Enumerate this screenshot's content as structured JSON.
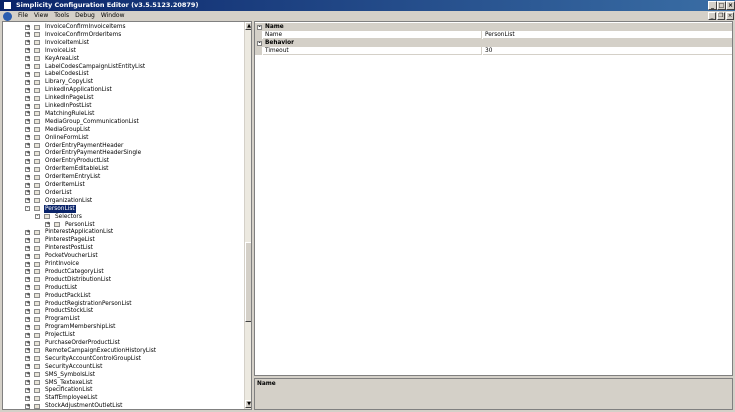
{
  "window": {
    "title": "Simplicity Configuration Editor (v3.5.5123.20879)"
  },
  "menu": [
    "File",
    "View",
    "Tools",
    "Debug",
    "Window"
  ],
  "tree": {
    "items": [
      {
        "label": "InvoiceConfirmInvoiceItems",
        "level": 0,
        "expander": "+"
      },
      {
        "label": "InvoiceConfirmOrderItems",
        "level": 0,
        "expander": "+"
      },
      {
        "label": "InvoiceItemList",
        "level": 0,
        "expander": "+"
      },
      {
        "label": "InvoiceList",
        "level": 0,
        "expander": "+"
      },
      {
        "label": "KeyAreaList",
        "level": 0,
        "expander": "+"
      },
      {
        "label": "LabelCodesCampaignListEntityList",
        "level": 0,
        "expander": "+"
      },
      {
        "label": "LabelCodesList",
        "level": 0,
        "expander": "+"
      },
      {
        "label": "Library_CopyList",
        "level": 0,
        "expander": "+"
      },
      {
        "label": "LinkedInApplicationList",
        "level": 0,
        "expander": "+"
      },
      {
        "label": "LinkedInPageList",
        "level": 0,
        "expander": "+"
      },
      {
        "label": "LinkedInPostList",
        "level": 0,
        "expander": "+"
      },
      {
        "label": "MatchingRuleList",
        "level": 0,
        "expander": "+"
      },
      {
        "label": "MediaGroup_CommunicationList",
        "level": 0,
        "expander": "+"
      },
      {
        "label": "MediaGroupList",
        "level": 0,
        "expander": "+"
      },
      {
        "label": "OnlineFormList",
        "level": 0,
        "expander": "+"
      },
      {
        "label": "OrderEntryPaymentHeader",
        "level": 0,
        "expander": "+"
      },
      {
        "label": "OrderEntryPaymentHeaderSingle",
        "level": 0,
        "expander": "+"
      },
      {
        "label": "OrderEntryProductList",
        "level": 0,
        "expander": "+"
      },
      {
        "label": "OrderItemEditableList",
        "level": 0,
        "expander": "+"
      },
      {
        "label": "OrderItemEntryList",
        "level": 0,
        "expander": "+"
      },
      {
        "label": "OrderItemList",
        "level": 0,
        "expander": "+"
      },
      {
        "label": "OrderList",
        "level": 0,
        "expander": "+"
      },
      {
        "label": "OrganizationList",
        "level": 0,
        "expander": "+"
      },
      {
        "label": "PersonList",
        "level": 0,
        "expander": "-",
        "selected": true
      },
      {
        "label": "Selectors",
        "level": 1,
        "expander": "-"
      },
      {
        "label": "PersonList",
        "level": 2,
        "expander": "+"
      },
      {
        "label": "PinterestApplicationList",
        "level": 0,
        "expander": "+"
      },
      {
        "label": "PinterestPageList",
        "level": 0,
        "expander": "+"
      },
      {
        "label": "PinterestPostList",
        "level": 0,
        "expander": "+"
      },
      {
        "label": "PocketVoucherList",
        "level": 0,
        "expander": "+"
      },
      {
        "label": "PrintInvoice",
        "level": 0,
        "expander": "+"
      },
      {
        "label": "ProductCategoryList",
        "level": 0,
        "expander": "+"
      },
      {
        "label": "ProductDistributionList",
        "level": 0,
        "expander": "+"
      },
      {
        "label": "ProductList",
        "level": 0,
        "expander": "+"
      },
      {
        "label": "ProductPackList",
        "level": 0,
        "expander": "+"
      },
      {
        "label": "ProductRegistrationPersonList",
        "level": 0,
        "expander": "+"
      },
      {
        "label": "ProductStockList",
        "level": 0,
        "expander": "+"
      },
      {
        "label": "ProgramList",
        "level": 0,
        "expander": "+"
      },
      {
        "label": "ProgramMembershipList",
        "level": 0,
        "expander": "+"
      },
      {
        "label": "ProjectList",
        "level": 0,
        "expander": "+"
      },
      {
        "label": "PurchaseOrderProductList",
        "level": 0,
        "expander": "+"
      },
      {
        "label": "RemoteCampaignExecutionHistoryList",
        "level": 0,
        "expander": "+"
      },
      {
        "label": "SecurityAccountControlGroupList",
        "level": 0,
        "expander": "+"
      },
      {
        "label": "SecurityAccountList",
        "level": 0,
        "expander": "+"
      },
      {
        "label": "SMS_SymbolsList",
        "level": 0,
        "expander": "+"
      },
      {
        "label": "SMS_TextexeList",
        "level": 0,
        "expander": "+"
      },
      {
        "label": "SpecificationList",
        "level": 0,
        "expander": "+"
      },
      {
        "label": "StaffEmployeeList",
        "level": 0,
        "expander": "+"
      },
      {
        "label": "StockAdjustmentOutletList",
        "level": 0,
        "expander": "+"
      }
    ]
  },
  "properties": {
    "categories": [
      {
        "label": "Name",
        "rows": [
          {
            "name": "Name",
            "value": "PersonList"
          }
        ]
      },
      {
        "label": "Behavior",
        "rows": [
          {
            "name": "Timeout",
            "value": "30"
          }
        ]
      }
    ]
  },
  "description": {
    "title": "Name"
  }
}
